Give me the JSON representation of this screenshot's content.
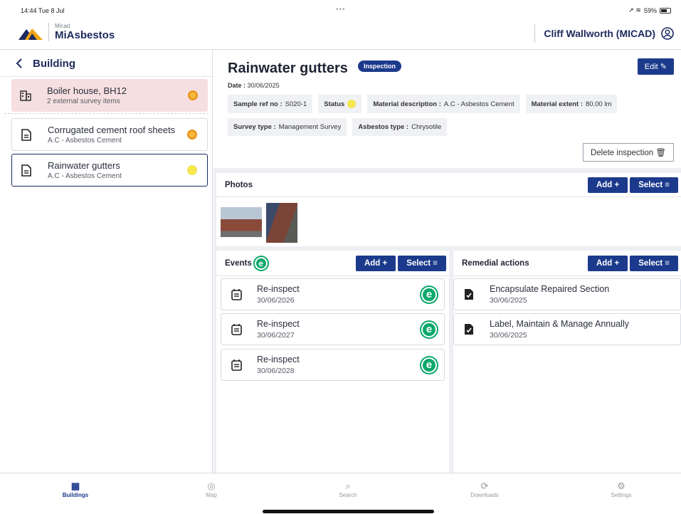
{
  "status_bar": {
    "time": "14:44  Tue 8 Jul",
    "dots": "•••",
    "battery": "59%"
  },
  "header": {
    "brand_small": "Micad",
    "brand_name": "MiAsbestos",
    "user_name": "Cliff Wallworth (MICAD)"
  },
  "sidebar": {
    "back_label": "Building",
    "items": [
      {
        "title": "Boiler house, BH12",
        "subtitle": "2 external survey items",
        "icon": "building-icon",
        "status": "orange"
      },
      {
        "title": "Corrugated cement roof sheets",
        "subtitle": "A.C - Asbestos Cement",
        "icon": "document-icon",
        "status": "orange"
      },
      {
        "title": "Rainwater gutters",
        "subtitle": "A.C - Asbestos Cement",
        "icon": "document-icon",
        "status": "yellow"
      }
    ]
  },
  "detail": {
    "title": "Rainwater gutters",
    "badge": "Inspection",
    "edit_label": "Edit",
    "date_label": "Date :",
    "date_value": "30/06/2025",
    "fields": [
      {
        "label": "Sample ref no :",
        "value": "S020-1"
      },
      {
        "label": "Status",
        "value": ""
      },
      {
        "label": "Material description :",
        "value": "A.C - Asbestos Cement"
      },
      {
        "label": "Material extent :",
        "value": "80.00 lm"
      },
      {
        "label": "Survey type :",
        "value": "Management Survey"
      },
      {
        "label": "Asbestos type :",
        "value": "Chrysotile"
      }
    ],
    "delete_label": "Delete inspection"
  },
  "photos": {
    "title": "Photos",
    "add_label": "Add +",
    "select_label": "Select ≡"
  },
  "events": {
    "title": "Events",
    "add_label": "Add +",
    "select_label": "Select ≡",
    "items": [
      {
        "title": "Re-inspect",
        "date": "30/06/2026"
      },
      {
        "title": "Re-inspect",
        "date": "30/06/2027"
      },
      {
        "title": "Re-inspect",
        "date": "30/06/2028"
      }
    ]
  },
  "remedial": {
    "title": "Remedial actions",
    "add_label": "Add +",
    "select_label": "Select ≡",
    "items": [
      {
        "title": "Encapsulate Repaired Section",
        "date": "30/06/2025"
      },
      {
        "title": "Label, Maintain & Manage Annually",
        "date": "30/06/2025"
      }
    ]
  },
  "tabbar": {
    "tabs": [
      "Buildings",
      "Map",
      "Search",
      "Downloads",
      "Settings"
    ],
    "active": "Buildings"
  },
  "colors": {
    "brand": "#1c3a8c",
    "selected_bg": "#f6dfe0",
    "event_green": "#0aa86b"
  }
}
